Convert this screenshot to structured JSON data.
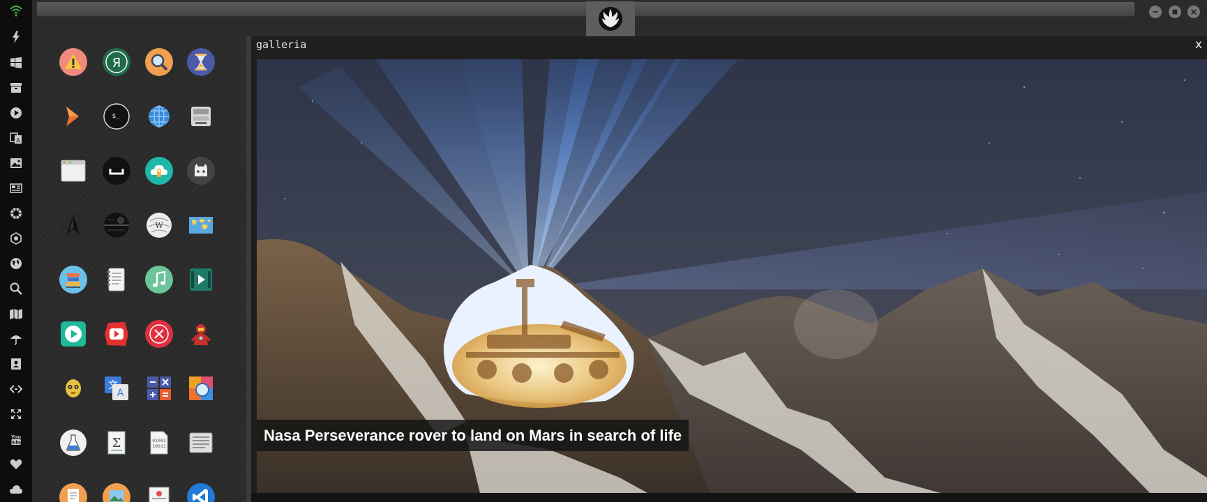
{
  "gallery": {
    "title": "galleria",
    "close_symbol": "x",
    "caption": "Nasa Perseverance rover to land on Mars in search of life"
  },
  "dock_icons": [
    "wifi-icon",
    "bolt-icon",
    "windows-icon",
    "archive-icon",
    "play-icon",
    "translate-icon",
    "image-icon",
    "news-icon",
    "rebel-alliance-icon",
    "empire-icon",
    "globe-icon",
    "search-icon",
    "map-icon",
    "umbrella-icon",
    "contacts-icon",
    "code-icon",
    "expand-icon",
    "youtube-icon",
    "heart-icon",
    "cloud-icon"
  ],
  "app_icons": [
    [
      "warning-icon",
      "yandex-icon",
      "search-app-icon",
      "hourglass-icon"
    ],
    [
      "chevron-launcher-icon",
      "terminal-icon",
      "globe-browser-icon",
      "drive-icon"
    ],
    [
      "window-app-icon",
      "spacebar-icon",
      "cloud-upload-icon",
      "github-icon"
    ],
    [
      "star-trek-icon",
      "death-star-icon",
      "wikipedia-icon",
      "world-map-icon"
    ],
    [
      "books-icon",
      "notebook-icon",
      "music-icon",
      "video-icon"
    ],
    [
      "play-store-icon",
      "youtube-app-icon",
      "close-app-icon",
      "iron-man-icon"
    ],
    [
      "c3po-icon",
      "translate-app-icon",
      "calculator-icon",
      "color-app-icon"
    ],
    [
      "flask-icon",
      "sigma-icon",
      "binary-file-icon",
      "text-file-icon"
    ],
    [
      "document-icon",
      "picture-icon",
      "presentation-icon",
      "vscode-icon"
    ]
  ],
  "colors": {
    "dock_bg": "#0d0d0d",
    "panel_bg": "#2a2a2a",
    "wifi_green": "#4caf50"
  }
}
